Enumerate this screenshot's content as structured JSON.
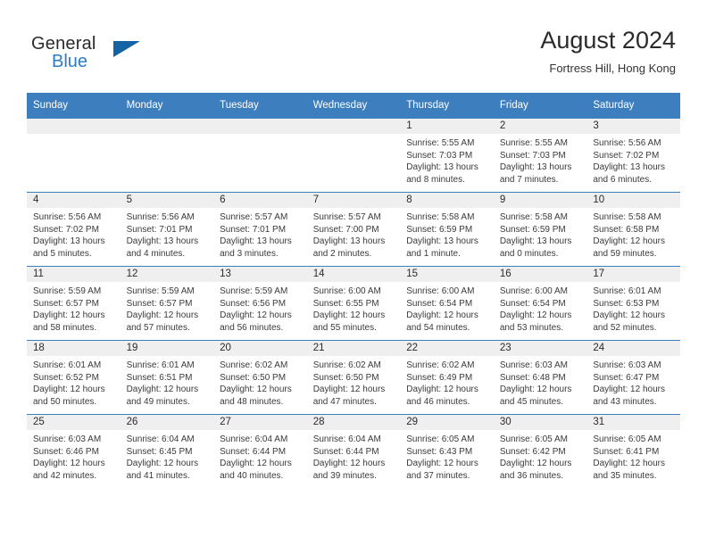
{
  "brand": {
    "word1": "General",
    "word2": "Blue",
    "logo_icon": "blue-triangle-logo",
    "accent_color": "#2b7cc4"
  },
  "header": {
    "title": "August 2024",
    "subtitle": "Fortress Hill, Hong Kong"
  },
  "calendar": {
    "header_bg": "#3d7ebe",
    "daynum_bg": "#efefef",
    "weekday_headers": [
      "Sunday",
      "Monday",
      "Tuesday",
      "Wednesday",
      "Thursday",
      "Friday",
      "Saturday"
    ],
    "weeks": [
      [
        {
          "day": "",
          "sunrise": "",
          "sunset": "",
          "daylight_l1": "",
          "daylight_l2": ""
        },
        {
          "day": "",
          "sunrise": "",
          "sunset": "",
          "daylight_l1": "",
          "daylight_l2": ""
        },
        {
          "day": "",
          "sunrise": "",
          "sunset": "",
          "daylight_l1": "",
          "daylight_l2": ""
        },
        {
          "day": "",
          "sunrise": "",
          "sunset": "",
          "daylight_l1": "",
          "daylight_l2": ""
        },
        {
          "day": "1",
          "sunrise": "Sunrise: 5:55 AM",
          "sunset": "Sunset: 7:03 PM",
          "daylight_l1": "Daylight: 13 hours",
          "daylight_l2": "and 8 minutes."
        },
        {
          "day": "2",
          "sunrise": "Sunrise: 5:55 AM",
          "sunset": "Sunset: 7:03 PM",
          "daylight_l1": "Daylight: 13 hours",
          "daylight_l2": "and 7 minutes."
        },
        {
          "day": "3",
          "sunrise": "Sunrise: 5:56 AM",
          "sunset": "Sunset: 7:02 PM",
          "daylight_l1": "Daylight: 13 hours",
          "daylight_l2": "and 6 minutes."
        }
      ],
      [
        {
          "day": "4",
          "sunrise": "Sunrise: 5:56 AM",
          "sunset": "Sunset: 7:02 PM",
          "daylight_l1": "Daylight: 13 hours",
          "daylight_l2": "and 5 minutes."
        },
        {
          "day": "5",
          "sunrise": "Sunrise: 5:56 AM",
          "sunset": "Sunset: 7:01 PM",
          "daylight_l1": "Daylight: 13 hours",
          "daylight_l2": "and 4 minutes."
        },
        {
          "day": "6",
          "sunrise": "Sunrise: 5:57 AM",
          "sunset": "Sunset: 7:01 PM",
          "daylight_l1": "Daylight: 13 hours",
          "daylight_l2": "and 3 minutes."
        },
        {
          "day": "7",
          "sunrise": "Sunrise: 5:57 AM",
          "sunset": "Sunset: 7:00 PM",
          "daylight_l1": "Daylight: 13 hours",
          "daylight_l2": "and 2 minutes."
        },
        {
          "day": "8",
          "sunrise": "Sunrise: 5:58 AM",
          "sunset": "Sunset: 6:59 PM",
          "daylight_l1": "Daylight: 13 hours",
          "daylight_l2": "and 1 minute."
        },
        {
          "day": "9",
          "sunrise": "Sunrise: 5:58 AM",
          "sunset": "Sunset: 6:59 PM",
          "daylight_l1": "Daylight: 13 hours",
          "daylight_l2": "and 0 minutes."
        },
        {
          "day": "10",
          "sunrise": "Sunrise: 5:58 AM",
          "sunset": "Sunset: 6:58 PM",
          "daylight_l1": "Daylight: 12 hours",
          "daylight_l2": "and 59 minutes."
        }
      ],
      [
        {
          "day": "11",
          "sunrise": "Sunrise: 5:59 AM",
          "sunset": "Sunset: 6:57 PM",
          "daylight_l1": "Daylight: 12 hours",
          "daylight_l2": "and 58 minutes."
        },
        {
          "day": "12",
          "sunrise": "Sunrise: 5:59 AM",
          "sunset": "Sunset: 6:57 PM",
          "daylight_l1": "Daylight: 12 hours",
          "daylight_l2": "and 57 minutes."
        },
        {
          "day": "13",
          "sunrise": "Sunrise: 5:59 AM",
          "sunset": "Sunset: 6:56 PM",
          "daylight_l1": "Daylight: 12 hours",
          "daylight_l2": "and 56 minutes."
        },
        {
          "day": "14",
          "sunrise": "Sunrise: 6:00 AM",
          "sunset": "Sunset: 6:55 PM",
          "daylight_l1": "Daylight: 12 hours",
          "daylight_l2": "and 55 minutes."
        },
        {
          "day": "15",
          "sunrise": "Sunrise: 6:00 AM",
          "sunset": "Sunset: 6:54 PM",
          "daylight_l1": "Daylight: 12 hours",
          "daylight_l2": "and 54 minutes."
        },
        {
          "day": "16",
          "sunrise": "Sunrise: 6:00 AM",
          "sunset": "Sunset: 6:54 PM",
          "daylight_l1": "Daylight: 12 hours",
          "daylight_l2": "and 53 minutes."
        },
        {
          "day": "17",
          "sunrise": "Sunrise: 6:01 AM",
          "sunset": "Sunset: 6:53 PM",
          "daylight_l1": "Daylight: 12 hours",
          "daylight_l2": "and 52 minutes."
        }
      ],
      [
        {
          "day": "18",
          "sunrise": "Sunrise: 6:01 AM",
          "sunset": "Sunset: 6:52 PM",
          "daylight_l1": "Daylight: 12 hours",
          "daylight_l2": "and 50 minutes."
        },
        {
          "day": "19",
          "sunrise": "Sunrise: 6:01 AM",
          "sunset": "Sunset: 6:51 PM",
          "daylight_l1": "Daylight: 12 hours",
          "daylight_l2": "and 49 minutes."
        },
        {
          "day": "20",
          "sunrise": "Sunrise: 6:02 AM",
          "sunset": "Sunset: 6:50 PM",
          "daylight_l1": "Daylight: 12 hours",
          "daylight_l2": "and 48 minutes."
        },
        {
          "day": "21",
          "sunrise": "Sunrise: 6:02 AM",
          "sunset": "Sunset: 6:50 PM",
          "daylight_l1": "Daylight: 12 hours",
          "daylight_l2": "and 47 minutes."
        },
        {
          "day": "22",
          "sunrise": "Sunrise: 6:02 AM",
          "sunset": "Sunset: 6:49 PM",
          "daylight_l1": "Daylight: 12 hours",
          "daylight_l2": "and 46 minutes."
        },
        {
          "day": "23",
          "sunrise": "Sunrise: 6:03 AM",
          "sunset": "Sunset: 6:48 PM",
          "daylight_l1": "Daylight: 12 hours",
          "daylight_l2": "and 45 minutes."
        },
        {
          "day": "24",
          "sunrise": "Sunrise: 6:03 AM",
          "sunset": "Sunset: 6:47 PM",
          "daylight_l1": "Daylight: 12 hours",
          "daylight_l2": "and 43 minutes."
        }
      ],
      [
        {
          "day": "25",
          "sunrise": "Sunrise: 6:03 AM",
          "sunset": "Sunset: 6:46 PM",
          "daylight_l1": "Daylight: 12 hours",
          "daylight_l2": "and 42 minutes."
        },
        {
          "day": "26",
          "sunrise": "Sunrise: 6:04 AM",
          "sunset": "Sunset: 6:45 PM",
          "daylight_l1": "Daylight: 12 hours",
          "daylight_l2": "and 41 minutes."
        },
        {
          "day": "27",
          "sunrise": "Sunrise: 6:04 AM",
          "sunset": "Sunset: 6:44 PM",
          "daylight_l1": "Daylight: 12 hours",
          "daylight_l2": "and 40 minutes."
        },
        {
          "day": "28",
          "sunrise": "Sunrise: 6:04 AM",
          "sunset": "Sunset: 6:44 PM",
          "daylight_l1": "Daylight: 12 hours",
          "daylight_l2": "and 39 minutes."
        },
        {
          "day": "29",
          "sunrise": "Sunrise: 6:05 AM",
          "sunset": "Sunset: 6:43 PM",
          "daylight_l1": "Daylight: 12 hours",
          "daylight_l2": "and 37 minutes."
        },
        {
          "day": "30",
          "sunrise": "Sunrise: 6:05 AM",
          "sunset": "Sunset: 6:42 PM",
          "daylight_l1": "Daylight: 12 hours",
          "daylight_l2": "and 36 minutes."
        },
        {
          "day": "31",
          "sunrise": "Sunrise: 6:05 AM",
          "sunset": "Sunset: 6:41 PM",
          "daylight_l1": "Daylight: 12 hours",
          "daylight_l2": "and 35 minutes."
        }
      ]
    ]
  }
}
